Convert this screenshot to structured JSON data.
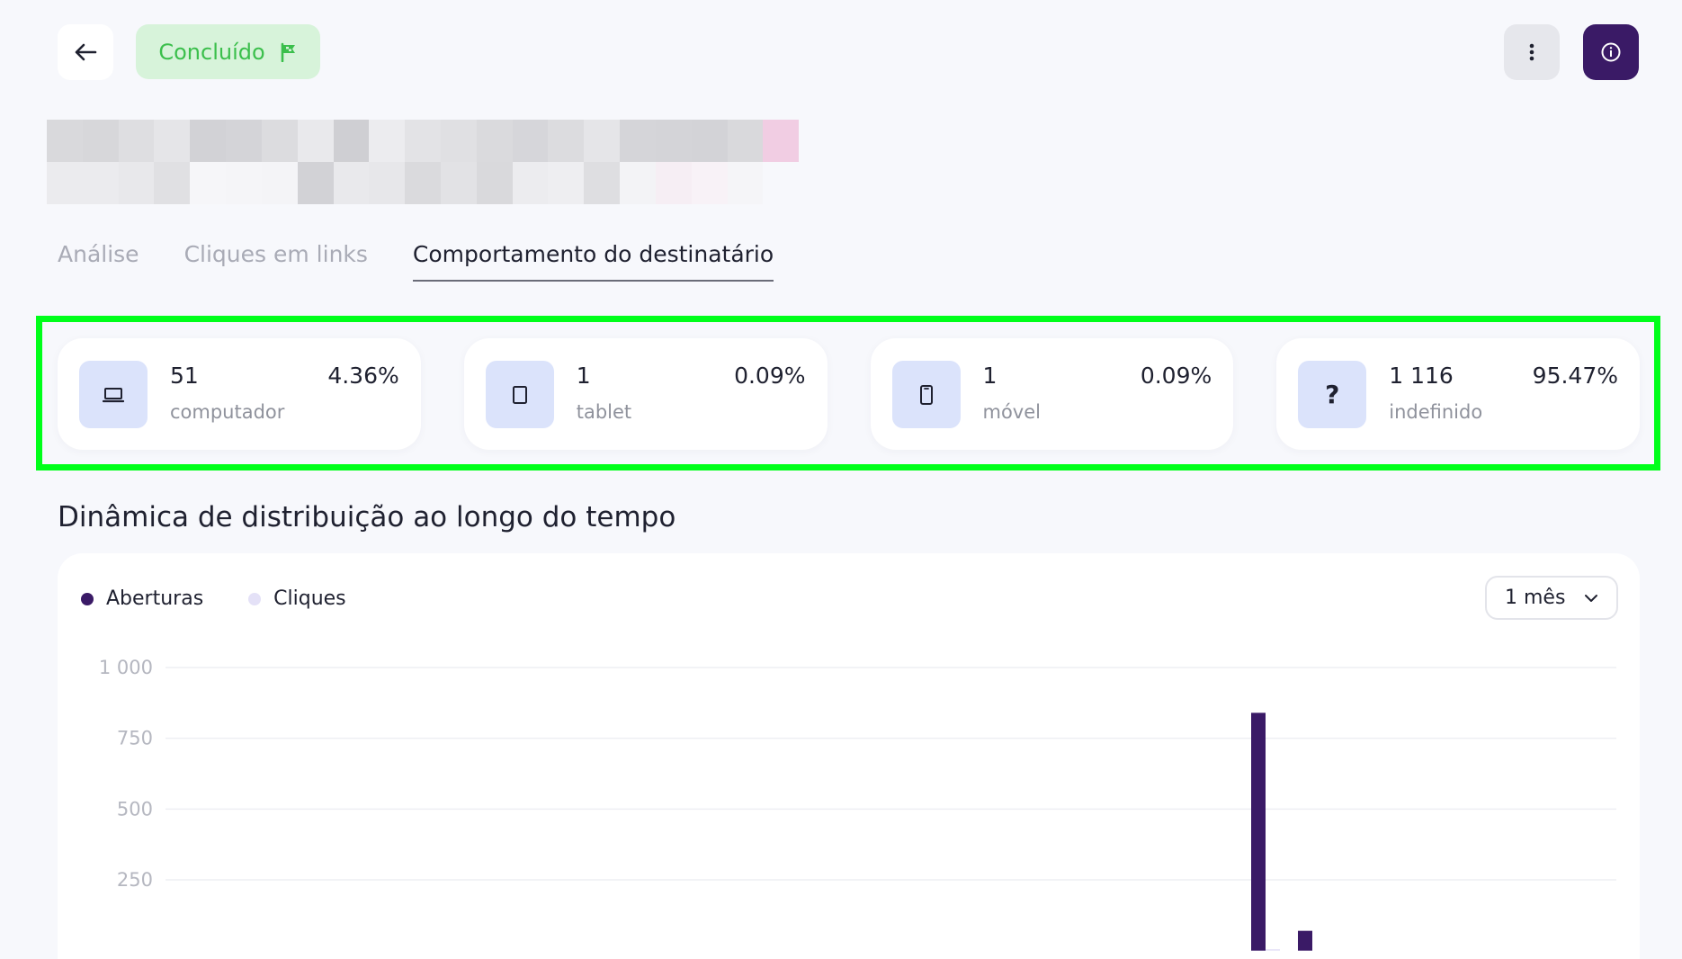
{
  "header": {
    "status_label": "Concluído",
    "status_color": "#3bbf4c"
  },
  "tabs": [
    {
      "label": "Análise",
      "active": false
    },
    {
      "label": "Cliques em links",
      "active": false
    },
    {
      "label": "Comportamento do destinatário",
      "active": true
    }
  ],
  "devices": [
    {
      "icon": "laptop-icon",
      "count": "51",
      "label": "computador",
      "percent": "4.36%"
    },
    {
      "icon": "tablet-icon",
      "count": "1",
      "label": "tablet",
      "percent": "0.09%"
    },
    {
      "icon": "phone-icon",
      "count": "1",
      "label": "móvel",
      "percent": "0.09%"
    },
    {
      "icon": "question-icon",
      "glyph": "?",
      "count": "1 116",
      "label": "indefinido",
      "percent": "95.47%"
    }
  ],
  "section_title": "Dinâmica de distribuição ao longo do tempo",
  "chart": {
    "period": "1 mês",
    "legend": [
      {
        "label": "Aberturas",
        "color": "#3a1a66"
      },
      {
        "label": "Cliques",
        "color": "#e4e1f7"
      }
    ]
  },
  "chart_data": {
    "type": "bar",
    "ylim": [
      0,
      1000
    ],
    "yticks": [
      "1 000",
      "750",
      "500",
      "250"
    ],
    "ytick_values": [
      1000,
      750,
      500,
      250
    ],
    "series": [
      {
        "name": "Aberturas",
        "color": "#3a1a66",
        "values": [
          840,
          70
        ]
      },
      {
        "name": "Cliques",
        "color": "#e4e1f7",
        "values": [
          5,
          0
        ]
      }
    ],
    "grid": true
  }
}
